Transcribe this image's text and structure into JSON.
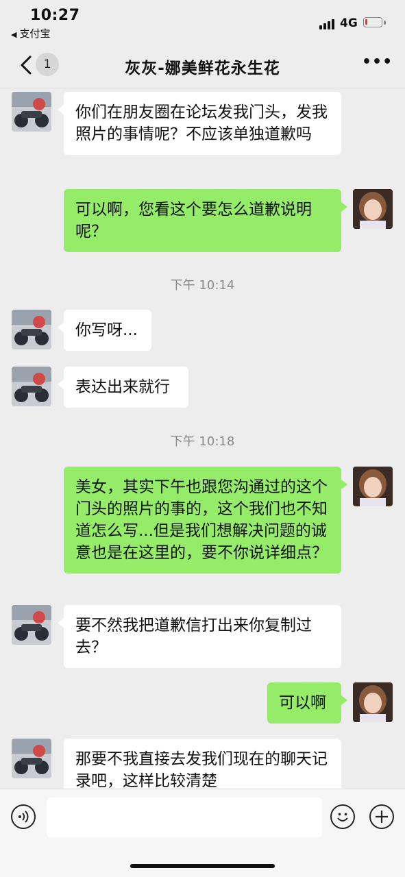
{
  "status_bar": {
    "time": "10:27",
    "back_app": "支付宝",
    "network": "4G",
    "battery_color": "#e33333"
  },
  "nav": {
    "unread_count": "1",
    "title": "灰灰-娜美鲜花永生花",
    "more_icon": "more-dots-icon"
  },
  "messages": [
    {
      "side": "in",
      "text": "你们在朋友圈在论坛发我门头，发我照片的事情呢？不应该单独道歉吗"
    },
    {
      "side": "out",
      "text": "可以啊，您看这个要怎么道歉说明呢？"
    },
    {
      "timestamp": "下午 10:14"
    },
    {
      "side": "in",
      "text": "你写呀..."
    },
    {
      "side": "in",
      "text": "表达出来就行"
    },
    {
      "timestamp": "下午 10:18"
    },
    {
      "side": "out",
      "text": "美女，其实下午也跟您沟通过的这个门头的照片的事的，这个我们也不知道怎么写...但是我们想解决问题的诚意也是在这里的，要不你说详细点？"
    },
    {
      "side": "in",
      "text": "要不然我把道歉信打出来你复制过去？"
    },
    {
      "side": "out",
      "text": "可以啊"
    },
    {
      "side": "in",
      "text": "那要不我直接去发我们现在的聊天记录吧，这样比较清楚"
    }
  ],
  "input_bar": {
    "voice_icon": "voice-icon",
    "emoji_icon": "emoji-icon",
    "add_icon": "plus-icon",
    "placeholder": ""
  },
  "colors": {
    "background": "#ededed",
    "incoming_bubble": "#ffffff",
    "outgoing_bubble": "#95ec69"
  }
}
